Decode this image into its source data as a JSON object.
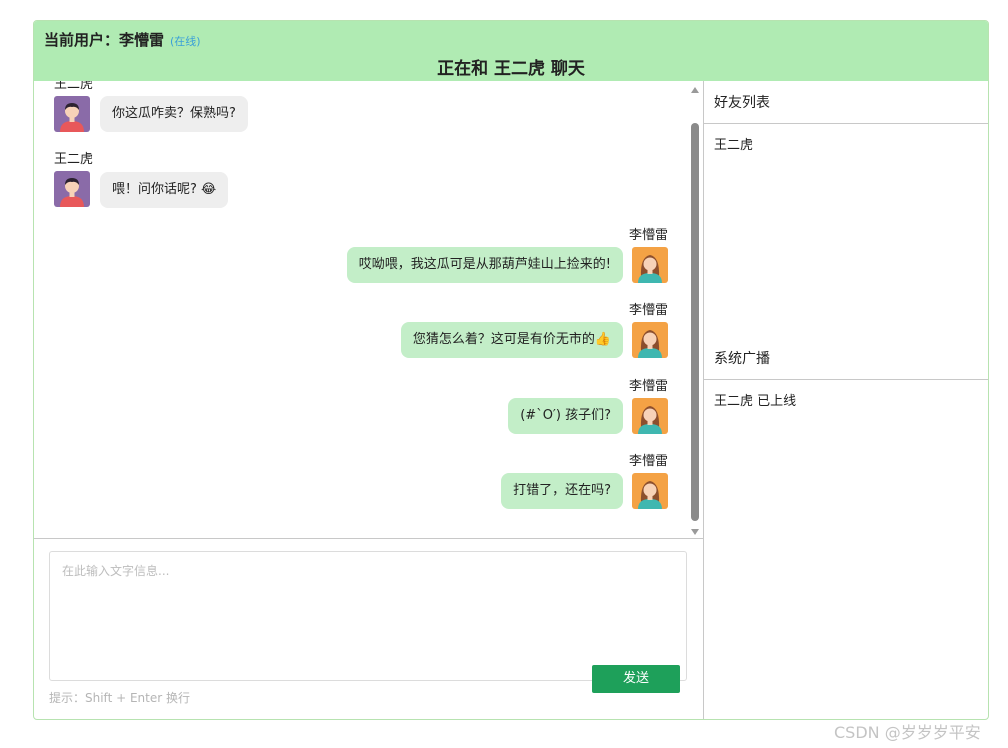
{
  "header": {
    "user_label": "当前用户：李懵雷",
    "status": "(在线)",
    "chat_title": "正在和 王二虎 聊天"
  },
  "messages": [
    {
      "side": "left",
      "sender": "王二虎",
      "text": "你这瓜咋卖？保熟吗?"
    },
    {
      "side": "left",
      "sender": "王二虎",
      "text": "喂！问你话呢? 😂"
    },
    {
      "side": "right",
      "sender": "李懵雷",
      "text": "哎呦喂，我这瓜可是从那葫芦娃山上捡来的!"
    },
    {
      "side": "right",
      "sender": "李懵雷",
      "text": "您猜怎么着？这可是有价无市的👍"
    },
    {
      "side": "right",
      "sender": "李懵雷",
      "text": "(#`O′) 孩子们?"
    },
    {
      "side": "right",
      "sender": "李懵雷",
      "text": "打错了，还在吗?"
    }
  ],
  "input": {
    "placeholder": "在此输入文字信息...",
    "send_label": "发送",
    "hint": "提示：Shift + Enter 换行"
  },
  "sidebar": {
    "friends_title": "好友列表",
    "friends": [
      "王二虎"
    ],
    "broadcast_title": "系统广播",
    "broadcasts": [
      "王二虎 已上线"
    ]
  },
  "watermark": "CSDN @岁岁岁平安",
  "colors": {
    "header_bg": "#b0ebb3",
    "own_bubble": "#c3eec8",
    "other_bubble": "#eeeeee",
    "send_button": "#1ea05a",
    "status": "#3aa0d8"
  }
}
